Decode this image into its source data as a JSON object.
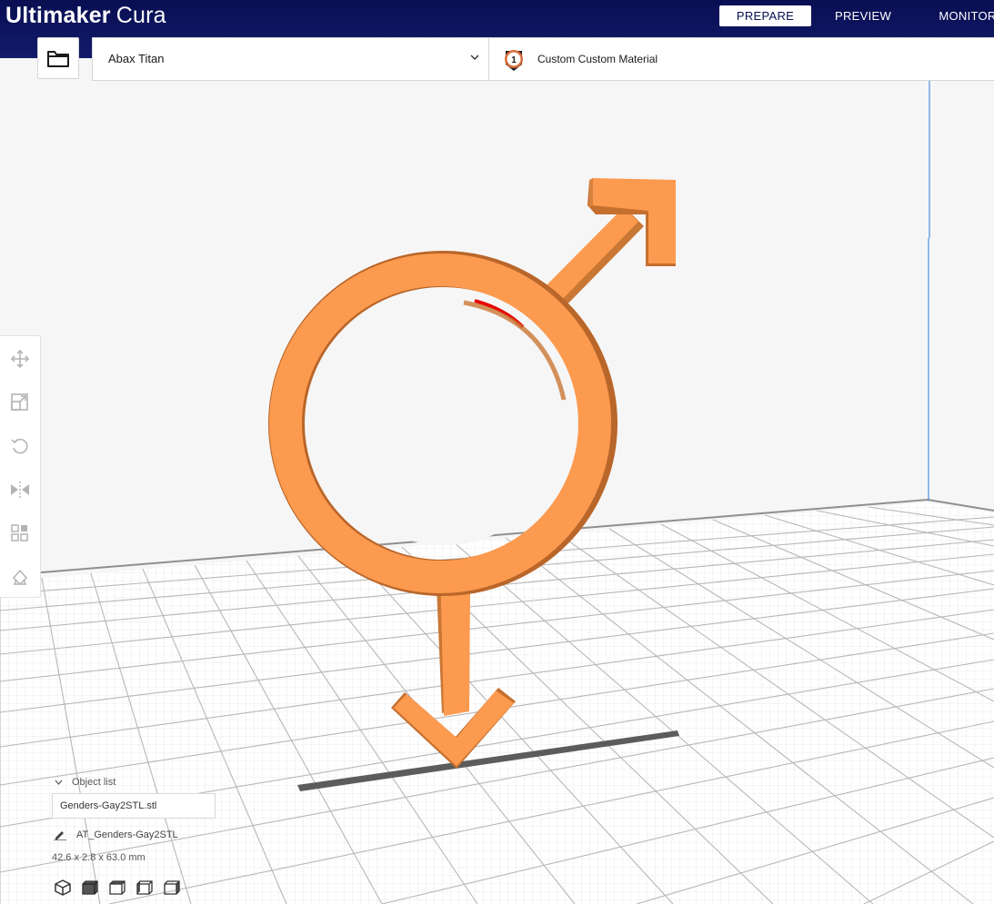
{
  "app": {
    "brand_bold": "Ultimaker",
    "brand_light": "Cura"
  },
  "stages": [
    {
      "label": "PREPARE",
      "active": true
    },
    {
      "label": "PREVIEW",
      "active": false
    },
    {
      "label": "MONITOR",
      "active": false
    }
  ],
  "header": {
    "open_icon": "folder-icon",
    "printer": "Abax Titan",
    "extruder_number": "1",
    "material": "Custom Custom Material"
  },
  "toolbar": {
    "tools": [
      {
        "name": "move-tool",
        "icon": "move-icon"
      },
      {
        "name": "scale-tool",
        "icon": "scale-icon"
      },
      {
        "name": "rotate-tool",
        "icon": "rotate-icon"
      },
      {
        "name": "mirror-tool",
        "icon": "mirror-icon"
      },
      {
        "name": "per-model-settings-tool",
        "icon": "per-model-settings-icon"
      },
      {
        "name": "support-blocker-tool",
        "icon": "support-blocker-icon"
      }
    ]
  },
  "object_list": {
    "heading": "Object list",
    "file": "Genders-Gay2STL.stl",
    "object_name": "AT_Genders-Gay2STL",
    "dimensions": "42.6 x 2.8 x 63.0 mm",
    "view_buttons": [
      "3d-view",
      "front-view",
      "top-view",
      "left-view",
      "right-view"
    ]
  },
  "colors": {
    "topbar": "#0a0f52",
    "model": "#fc9a4f",
    "model_shadow": "#c06a2c",
    "build_plate": "#ffffff",
    "grid": "#b9b9b9",
    "build_volume_edge": "#2a7fd8",
    "overhang": "#ff0000"
  }
}
